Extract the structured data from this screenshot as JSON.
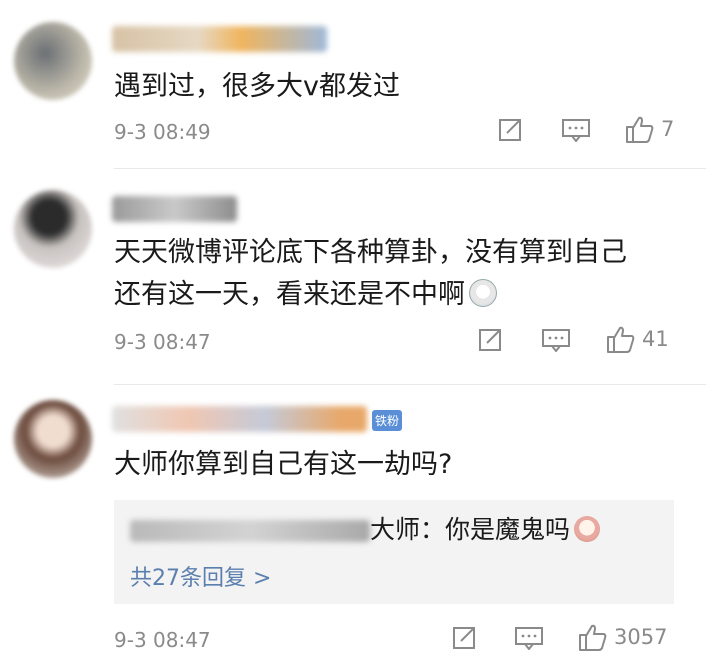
{
  "comments": [
    {
      "text": [
        "遇到过，很多大v都发过"
      ],
      "time": "9-3 08:49",
      "likes": "7"
    },
    {
      "text": [
        "天天微博评论底下各种算卦，没有算到自己",
        "还有这一天，看来还是不中啊"
      ],
      "time": "9-3 08:47",
      "likes": "41"
    },
    {
      "text": [
        "大师你算到自己有这一劫吗?"
      ],
      "badge": "铁粉",
      "time": "9-3 08:47",
      "likes": "3057",
      "reply": {
        "preview_text": "大师：你是魔鬼吗",
        "more_link": "共27条回复 >"
      }
    }
  ],
  "icons": {
    "share": "share-icon",
    "comment": "comment-icon",
    "like": "thumbs-up-icon",
    "emoji_dizzy": "dizzy-face-emoji-icon",
    "emoji_face": "face-emoji-icon"
  },
  "colors": {
    "text": "#1a1a1a",
    "meta": "#8a8a8a",
    "link": "#5b7fae",
    "reply_bg": "#f3f3f3"
  }
}
